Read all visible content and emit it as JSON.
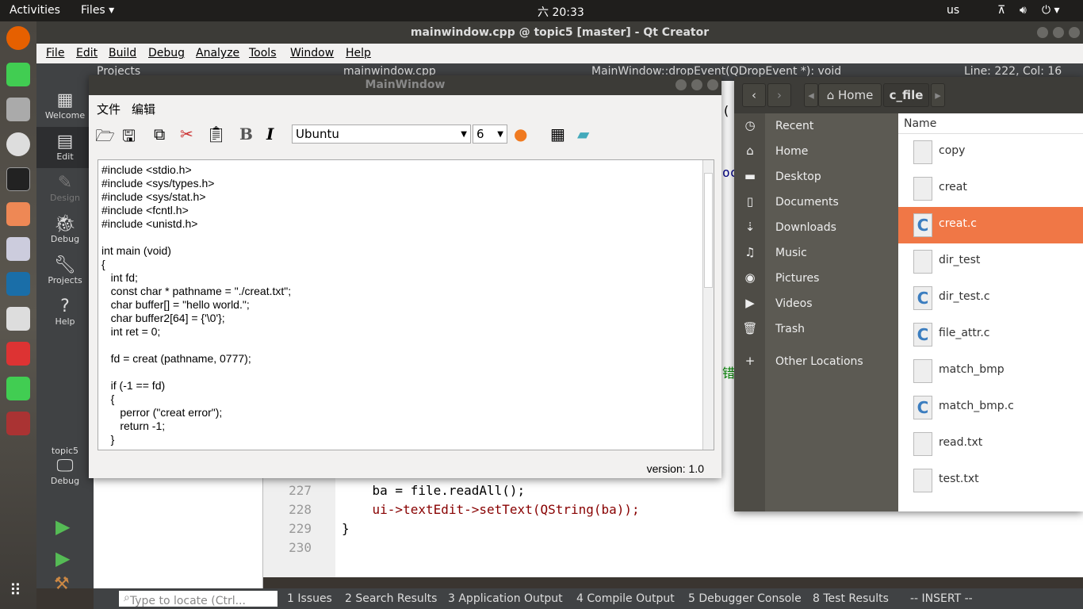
{
  "topbar": {
    "activities": "Activities",
    "app": "Files ▾",
    "clock": "六 20:33",
    "keyboard": "us"
  },
  "qt": {
    "title": "mainwindow.cpp @ topic5 [master] - Qt Creator",
    "menu": [
      "File",
      "Edit",
      "Build",
      "Debug",
      "Analyze",
      "Tools",
      "Window",
      "Help"
    ],
    "toolbar": {
      "projects": "Projects",
      "file": "mainwindow.cpp",
      "symbol": "MainWindow::dropEvent(QDropEvent *): void",
      "position": "Line: 222, Col: 16"
    },
    "modes": [
      "Welcome",
      "Edit",
      "Design",
      "Debug",
      "Projects",
      "Help"
    ],
    "kit": {
      "project": "topic5",
      "mode": "Debug"
    },
    "code": {
      "lines": [
        {
          "n": "227",
          "text": "    ba = file.readAll();"
        },
        {
          "n": "228",
          "text": "    ui->textEdit->setText(QString(ba));"
        },
        {
          "n": "229",
          "text": "}"
        },
        {
          "n": "230",
          "text": ""
        }
      ],
      "fragments": [
        "( )",
        "oc",
        "错"
      ]
    },
    "status": {
      "locate_placeholder": "Type to locate (Ctrl...",
      "panes": [
        "1  Issues",
        "2  Search Results",
        "3  Application Output",
        "4  Compile Output",
        "5  Debugger Console",
        "8  Test Results"
      ],
      "mode": "-- INSERT --"
    }
  },
  "mainwindow": {
    "title": "MainWindow",
    "menu": [
      "文件",
      "编辑"
    ],
    "font": "Ubuntu",
    "size": "6",
    "version": "version: 1.0",
    "text": [
      "#include <stdio.h>",
      "#include <sys/types.h>",
      "#include <sys/stat.h>",
      "#include <fcntl.h>",
      "#include <unistd.h>",
      "",
      "int main (void)",
      "{",
      "   int fd;",
      "   const char * pathname = \"./creat.txt\";",
      "   char buffer[] = \"hello world.\";",
      "   char buffer2[64] = {'\\0'};",
      "   int ret = 0;",
      "",
      "   fd = creat (pathname, 0777);",
      "",
      "   if (-1 == fd)",
      "   {",
      "      perror (\"creat error\");",
      "      return -1;",
      "   }"
    ]
  },
  "files": {
    "path": [
      "Home",
      "c_file"
    ],
    "sidebar": [
      {
        "icon": "clock-icon",
        "label": "Recent"
      },
      {
        "icon": "home-icon",
        "label": "Home"
      },
      {
        "icon": "folder-icon",
        "label": "Desktop"
      },
      {
        "icon": "document-icon",
        "label": "Documents"
      },
      {
        "icon": "download-icon",
        "label": "Downloads"
      },
      {
        "icon": "music-icon",
        "label": "Music"
      },
      {
        "icon": "camera-icon",
        "label": "Pictures"
      },
      {
        "icon": "video-icon",
        "label": "Videos"
      },
      {
        "icon": "trash-icon",
        "label": "Trash"
      },
      {
        "icon": "plus-icon",
        "label": "Other Locations"
      }
    ],
    "column": "Name",
    "items": [
      {
        "name": "copy",
        "type": "file"
      },
      {
        "name": "creat",
        "type": "file"
      },
      {
        "name": "creat.c",
        "type": "c",
        "selected": true
      },
      {
        "name": "dir_test",
        "type": "file"
      },
      {
        "name": "dir_test.c",
        "type": "c"
      },
      {
        "name": "file_attr.c",
        "type": "c"
      },
      {
        "name": "match_bmp",
        "type": "file"
      },
      {
        "name": "match_bmp.c",
        "type": "c"
      },
      {
        "name": "read.txt",
        "type": "file"
      },
      {
        "name": "test.txt",
        "type": "file"
      }
    ],
    "accent": "#f07746"
  }
}
